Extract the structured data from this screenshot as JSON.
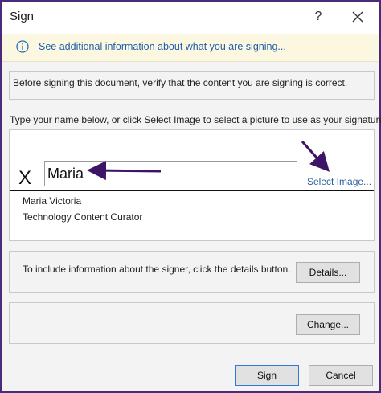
{
  "dialog": {
    "title": "Sign",
    "help_glyph": "?",
    "close_label": "close"
  },
  "infobar": {
    "link_text": "See additional information about what you are signing..."
  },
  "verify": {
    "text": "Before signing this document, verify that the content you are signing is correct."
  },
  "instruction": {
    "text": "Type your name below, or click Select Image to select a picture to use as your signature:"
  },
  "signature": {
    "x_mark": "X",
    "input_value": "Maria",
    "select_image_label": "Select Image...",
    "signer_name": "Maria Victoria",
    "signer_title": "Technology Content Curator"
  },
  "details": {
    "text": "To include information about the signer, click the details button.",
    "button_label": "Details..."
  },
  "change": {
    "button_label": "Change..."
  },
  "footer": {
    "sign_label": "Sign",
    "cancel_label": "Cancel"
  },
  "colors": {
    "frame": "#4a2a7a",
    "annotation_arrow": "#3d1466",
    "link": "#1f5ea8",
    "infobar_bg": "#fbf7e1"
  },
  "icons": {
    "info": "info-icon",
    "close": "close-icon",
    "help": "help-icon"
  }
}
